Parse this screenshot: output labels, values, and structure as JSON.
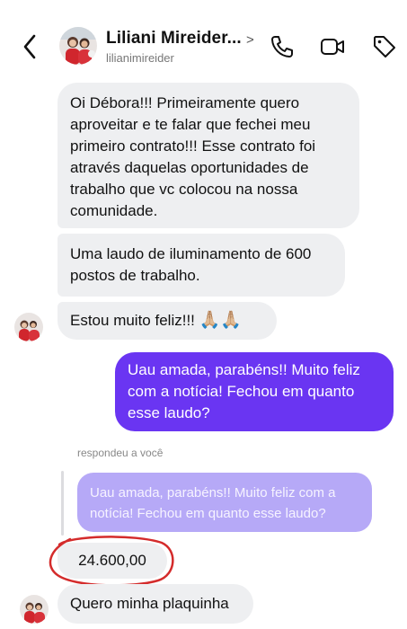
{
  "header": {
    "name": "Liliani Mireider...",
    "username": "lilianimireider",
    "chevron": ">",
    "icons": [
      "back-arrow-icon",
      "phone-icon",
      "video-icon",
      "tag-icon"
    ]
  },
  "messages": {
    "m1": "Oi Débora!!! Primeiramente quero aproveitar e te falar que fechei meu primeiro contrato!!! Esse contrato foi através daquelas oportunidades de trabalho que vc colocou na nossa comunidade.",
    "m2": "Uma laudo de iluminamento de 600 postos de trabalho.",
    "m3": "Estou muito feliz!!!",
    "m3_emoji": "🙏🏼🙏🏼",
    "out1": "Uau amada, parabéns!! Muito feliz com a notícia! Fechou em quanto esse laudo?",
    "reply_label": "respondeu a você",
    "quoted": "Uau amada, parabéns!! Muito feliz com a notícia! Fechou em quanto esse laudo?",
    "m4": "24.600,00",
    "m5": "Quero minha plaquinha"
  },
  "colors": {
    "outgoing": "#6a35f2",
    "incoming": "#eeeff1",
    "quoted": "#b6a9f7",
    "annotation": "#d42b2b"
  }
}
